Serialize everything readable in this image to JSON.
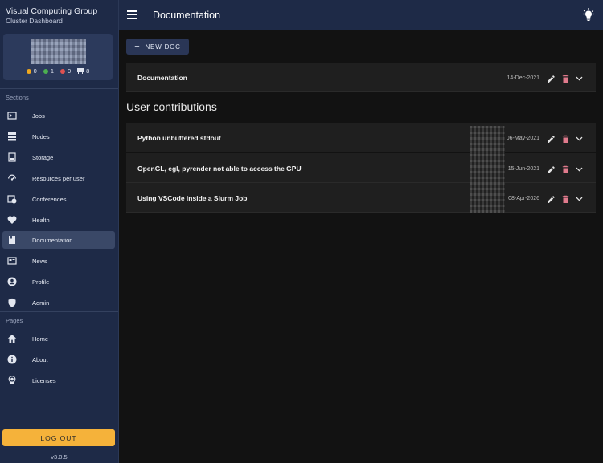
{
  "app": {
    "title": "Visual Computing Group",
    "subtitle": "Cluster Dashboard",
    "version": "v3.0.5"
  },
  "user_card": {
    "stats": [
      {
        "value": "0",
        "color": "#f0a81e"
      },
      {
        "value": "1",
        "color": "#4caf50"
      },
      {
        "value": "0",
        "color": "#e05252"
      },
      {
        "value": "8",
        "icon": "gpu-icon"
      }
    ]
  },
  "sidebar": {
    "sections_label": "Sections",
    "sections": [
      {
        "label": "Jobs",
        "icon": "terminal-icon"
      },
      {
        "label": "Nodes",
        "icon": "server-icon"
      },
      {
        "label": "Storage",
        "icon": "storage-icon"
      },
      {
        "label": "Resources per user",
        "icon": "speedometer-icon"
      },
      {
        "label": "Conferences",
        "icon": "calendar-clock-icon"
      },
      {
        "label": "Health",
        "icon": "heartbeat-icon"
      },
      {
        "label": "Documentation",
        "icon": "book-icon",
        "active": true
      },
      {
        "label": "News",
        "icon": "newspaper-icon"
      },
      {
        "label": "Profile",
        "icon": "account-icon"
      },
      {
        "label": "Admin",
        "icon": "shield-icon"
      }
    ],
    "pages_label": "Pages",
    "pages": [
      {
        "label": "Home",
        "icon": "home-icon"
      },
      {
        "label": "About",
        "icon": "info-icon"
      },
      {
        "label": "Licenses",
        "icon": "certificate-icon"
      }
    ],
    "logout_label": "LOG OUT"
  },
  "header": {
    "title": "Documentation",
    "theme_icon": "lightbulb-icon"
  },
  "main": {
    "new_doc_label": "NEW DOC",
    "docs": [
      {
        "title": "Documentation",
        "date": "14-Dec-2021"
      }
    ],
    "contributions_heading": "User contributions",
    "contributions": [
      {
        "title": "Python unbuffered stdout",
        "date": "06-May-2021"
      },
      {
        "title": "OpenGL, egl, pyrender not able to access the GPU",
        "date": "15-Jun-2021"
      },
      {
        "title": "Using VSCode inside a Slurm Job",
        "date": "08-Apr-2026"
      }
    ]
  }
}
